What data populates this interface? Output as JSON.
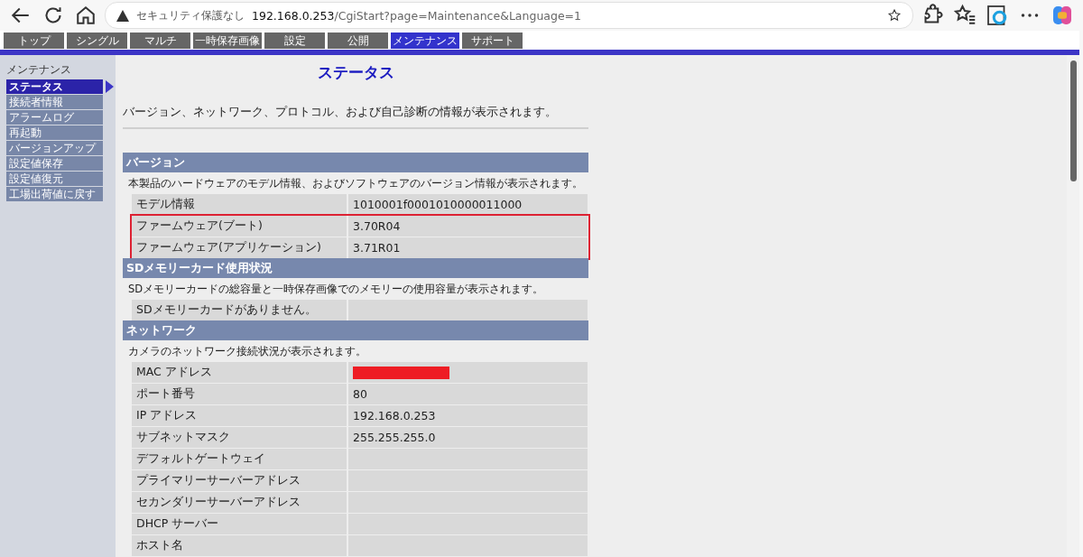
{
  "browser": {
    "security": "セキュリティ保護なし",
    "url_host": "192.168.0.253",
    "url_path": "/CgiStart?page=Maintenance&Language=1"
  },
  "tabs": [
    {
      "label": "トップ",
      "selected": false
    },
    {
      "label": "シングル",
      "selected": false
    },
    {
      "label": "マルチ",
      "selected": false
    },
    {
      "label": "一時保存画像",
      "selected": false
    },
    {
      "label": "設定",
      "selected": false
    },
    {
      "label": "公開",
      "selected": false
    },
    {
      "label": "メンテナンス",
      "selected": true
    },
    {
      "label": "サポート",
      "selected": false
    }
  ],
  "sidebar": {
    "title": "メンテナンス",
    "items": [
      {
        "label": "ステータス",
        "selected": true
      },
      {
        "label": "接続者情報",
        "selected": false
      },
      {
        "label": "アラームログ",
        "selected": false
      },
      {
        "label": "再起動",
        "selected": false
      },
      {
        "label": "バージョンアップ",
        "selected": false
      },
      {
        "label": "設定値保存",
        "selected": false
      },
      {
        "label": "設定値復元",
        "selected": false
      },
      {
        "label": "工場出荷値に戻す",
        "selected": false
      }
    ]
  },
  "page": {
    "title": "ステータス",
    "description": "バージョン、ネットワーク、プロトコル、および自己診断の情報が表示されます。"
  },
  "sections": [
    {
      "title": "バージョン",
      "description": "本製品のハードウェアのモデル情報、およびソフトウェアのバージョン情報が表示されます。",
      "rows": [
        {
          "label": "モデル情報",
          "value": "1010001f0001010000011000",
          "highlighted": false
        },
        {
          "label": "ファームウェア(ブート)",
          "value": "3.70R04",
          "highlighted": true
        },
        {
          "label": "ファームウェア(アプリケーション)",
          "value": "3.71R01",
          "highlighted": true
        }
      ]
    },
    {
      "title": "SDメモリーカード使用状況",
      "description": "SDメモリーカードの総容量と一時保存画像でのメモリーの使用容量が表示されます。",
      "rows": [
        {
          "label": "SDメモリーカードがありません。",
          "highlighted": false
        }
      ]
    },
    {
      "title": "ネットワーク",
      "description": "カメラのネットワーク接続状況が表示されます。",
      "rows": [
        {
          "label": "MAC アドレス",
          "redacted": true,
          "highlighted": false
        },
        {
          "label": "ポート番号",
          "value": "80",
          "highlighted": false
        },
        {
          "label": "IP アドレス",
          "value": "192.168.0.253",
          "highlighted": false
        },
        {
          "label": "サブネットマスク",
          "value": "255.255.255.0",
          "highlighted": false
        },
        {
          "label": "デフォルトゲートウェイ",
          "highlighted": false
        },
        {
          "label": "プライマリーサーバーアドレス",
          "highlighted": false
        },
        {
          "label": "セカンダリーサーバーアドレス",
          "highlighted": false
        },
        {
          "label": "DHCP サーバー",
          "highlighted": false
        },
        {
          "label": "ホスト名",
          "highlighted": false
        }
      ]
    }
  ]
}
